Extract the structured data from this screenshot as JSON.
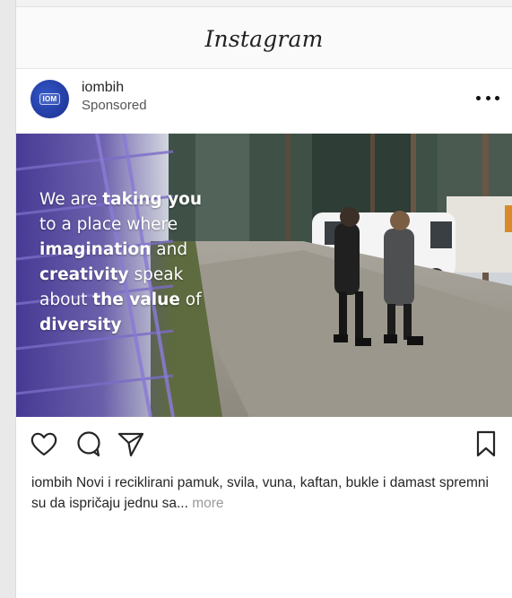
{
  "app": {
    "logo_text": "Instagram"
  },
  "post": {
    "username": "iombih",
    "sponsored_label": "Sponsored",
    "avatar_mark": "IOM",
    "more_label": "More options",
    "overlay_lines": [
      {
        "normal": "We are ",
        "bold": "taking you"
      },
      {
        "normal": "to a place where",
        "bold": ""
      },
      {
        "normal": "",
        "bold": "imagination",
        "after": " and"
      },
      {
        "normal": "",
        "bold": "creativity",
        "after": " speak"
      },
      {
        "normal": "about ",
        "bold": "the value",
        "after": " of"
      },
      {
        "normal": "",
        "bold": "diversity"
      }
    ],
    "caption_user": "iombih",
    "caption_text": " Novi i reciklirani pamuk, svila, vuna, kaftan, bukle i damast spremni su da ispričaju jednu sa...",
    "caption_more": " more"
  },
  "icons": {
    "like": "heart-icon",
    "comment": "comment-icon",
    "share": "share-icon",
    "save": "bookmark-icon"
  },
  "colors": {
    "avatar": "#2442a8",
    "text": "#262626",
    "muted": "#9a9a9a",
    "overlay_purple": "#3b2d8a"
  }
}
